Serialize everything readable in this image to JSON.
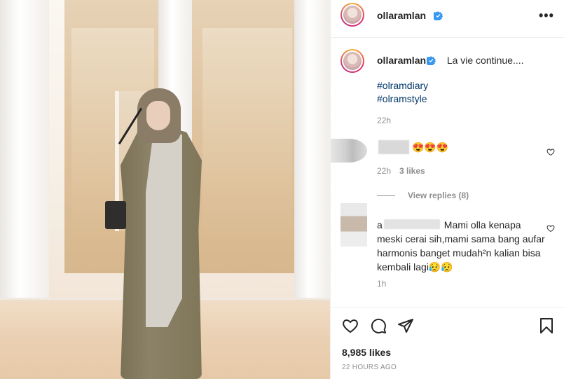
{
  "post": {
    "username": "ollaramlan",
    "caption_text": "La vie continue....",
    "hashtags": [
      "#olramdiary",
      "#olramstyle"
    ],
    "caption_time": "22h",
    "likes": "8,985 likes",
    "posted_ago": "22 HOURS AGO"
  },
  "comments": [
    {
      "emoji": "😍😍😍",
      "time": "22h",
      "likes": "3 likes",
      "view_replies": "View replies (8)"
    },
    {
      "username_visible": "a",
      "text": "Mami olla kenapa meski cerai sih,mami sama bang aufar harmonis banget mudah²n kalian bisa kembali lagi😥😥",
      "time": "1h"
    }
  ],
  "icons": {
    "verified": "verified-badge-icon",
    "more": "more-options-icon",
    "heart": "heart-icon",
    "comment": "comment-icon",
    "share": "share-icon",
    "save": "bookmark-icon"
  },
  "colors": {
    "verified_blue": "#3897f0",
    "hashtag": "#00376b",
    "muted": "#8e8e8e"
  }
}
